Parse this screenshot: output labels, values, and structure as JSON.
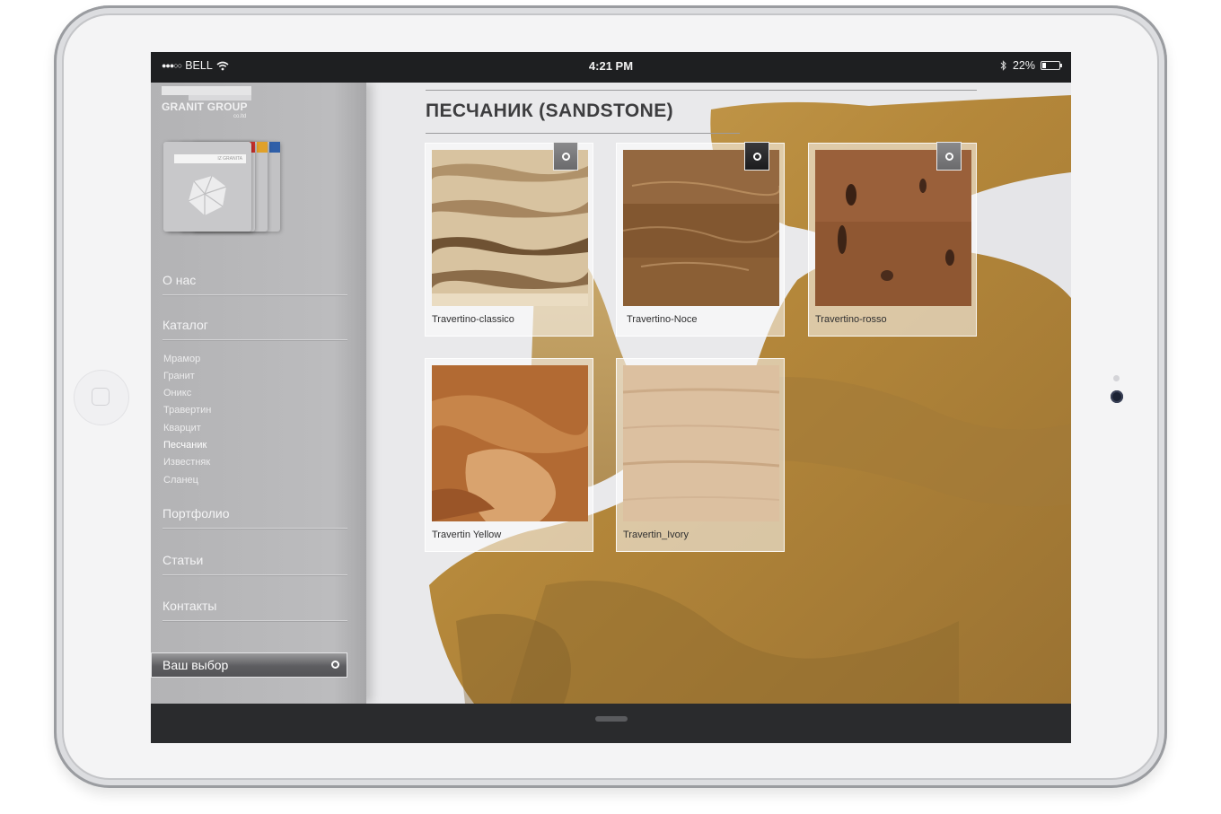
{
  "status_bar": {
    "signal": "●●●○○",
    "carrier": "BELL",
    "time": "4:21 PM",
    "battery_text": "22%",
    "battery_level": 0.22
  },
  "sidebar": {
    "logo": {
      "name": "GRANIT GROUP",
      "sub": "co.ltd"
    },
    "catalog_card_text": "IZ GRANITA",
    "nav": [
      {
        "label": "О нас"
      },
      {
        "label": "Каталог"
      },
      {
        "label": "Портфолио"
      },
      {
        "label": "Статьи"
      },
      {
        "label": "Контакты"
      }
    ],
    "catalog_items": [
      {
        "label": "Мрамор"
      },
      {
        "label": "Гранит"
      },
      {
        "label": "Оникс"
      },
      {
        "label": "Травертин"
      },
      {
        "label": "Кварцит"
      },
      {
        "label": "Песчаник",
        "active": true
      },
      {
        "label": "Известняк"
      },
      {
        "label": "Сланец"
      }
    ],
    "choice_button": "Ваш выбор"
  },
  "main": {
    "title": "ПЕСЧАНИК (SANDSTONE)",
    "products": [
      {
        "name": "Travertino-classico",
        "pin": "grey"
      },
      {
        "name": "Travertino-Noce",
        "pin": "black"
      },
      {
        "name": "Travertino-rosso",
        "pin": "grey"
      },
      {
        "name": "Travertin Yellow"
      },
      {
        "name": "Travertin_Ivory"
      }
    ]
  },
  "colors": {
    "sidebar": "#b8b8ba",
    "content_bg": "#e9e9eb",
    "sandstone": "#b8893a",
    "title": "#3d3d3f"
  }
}
